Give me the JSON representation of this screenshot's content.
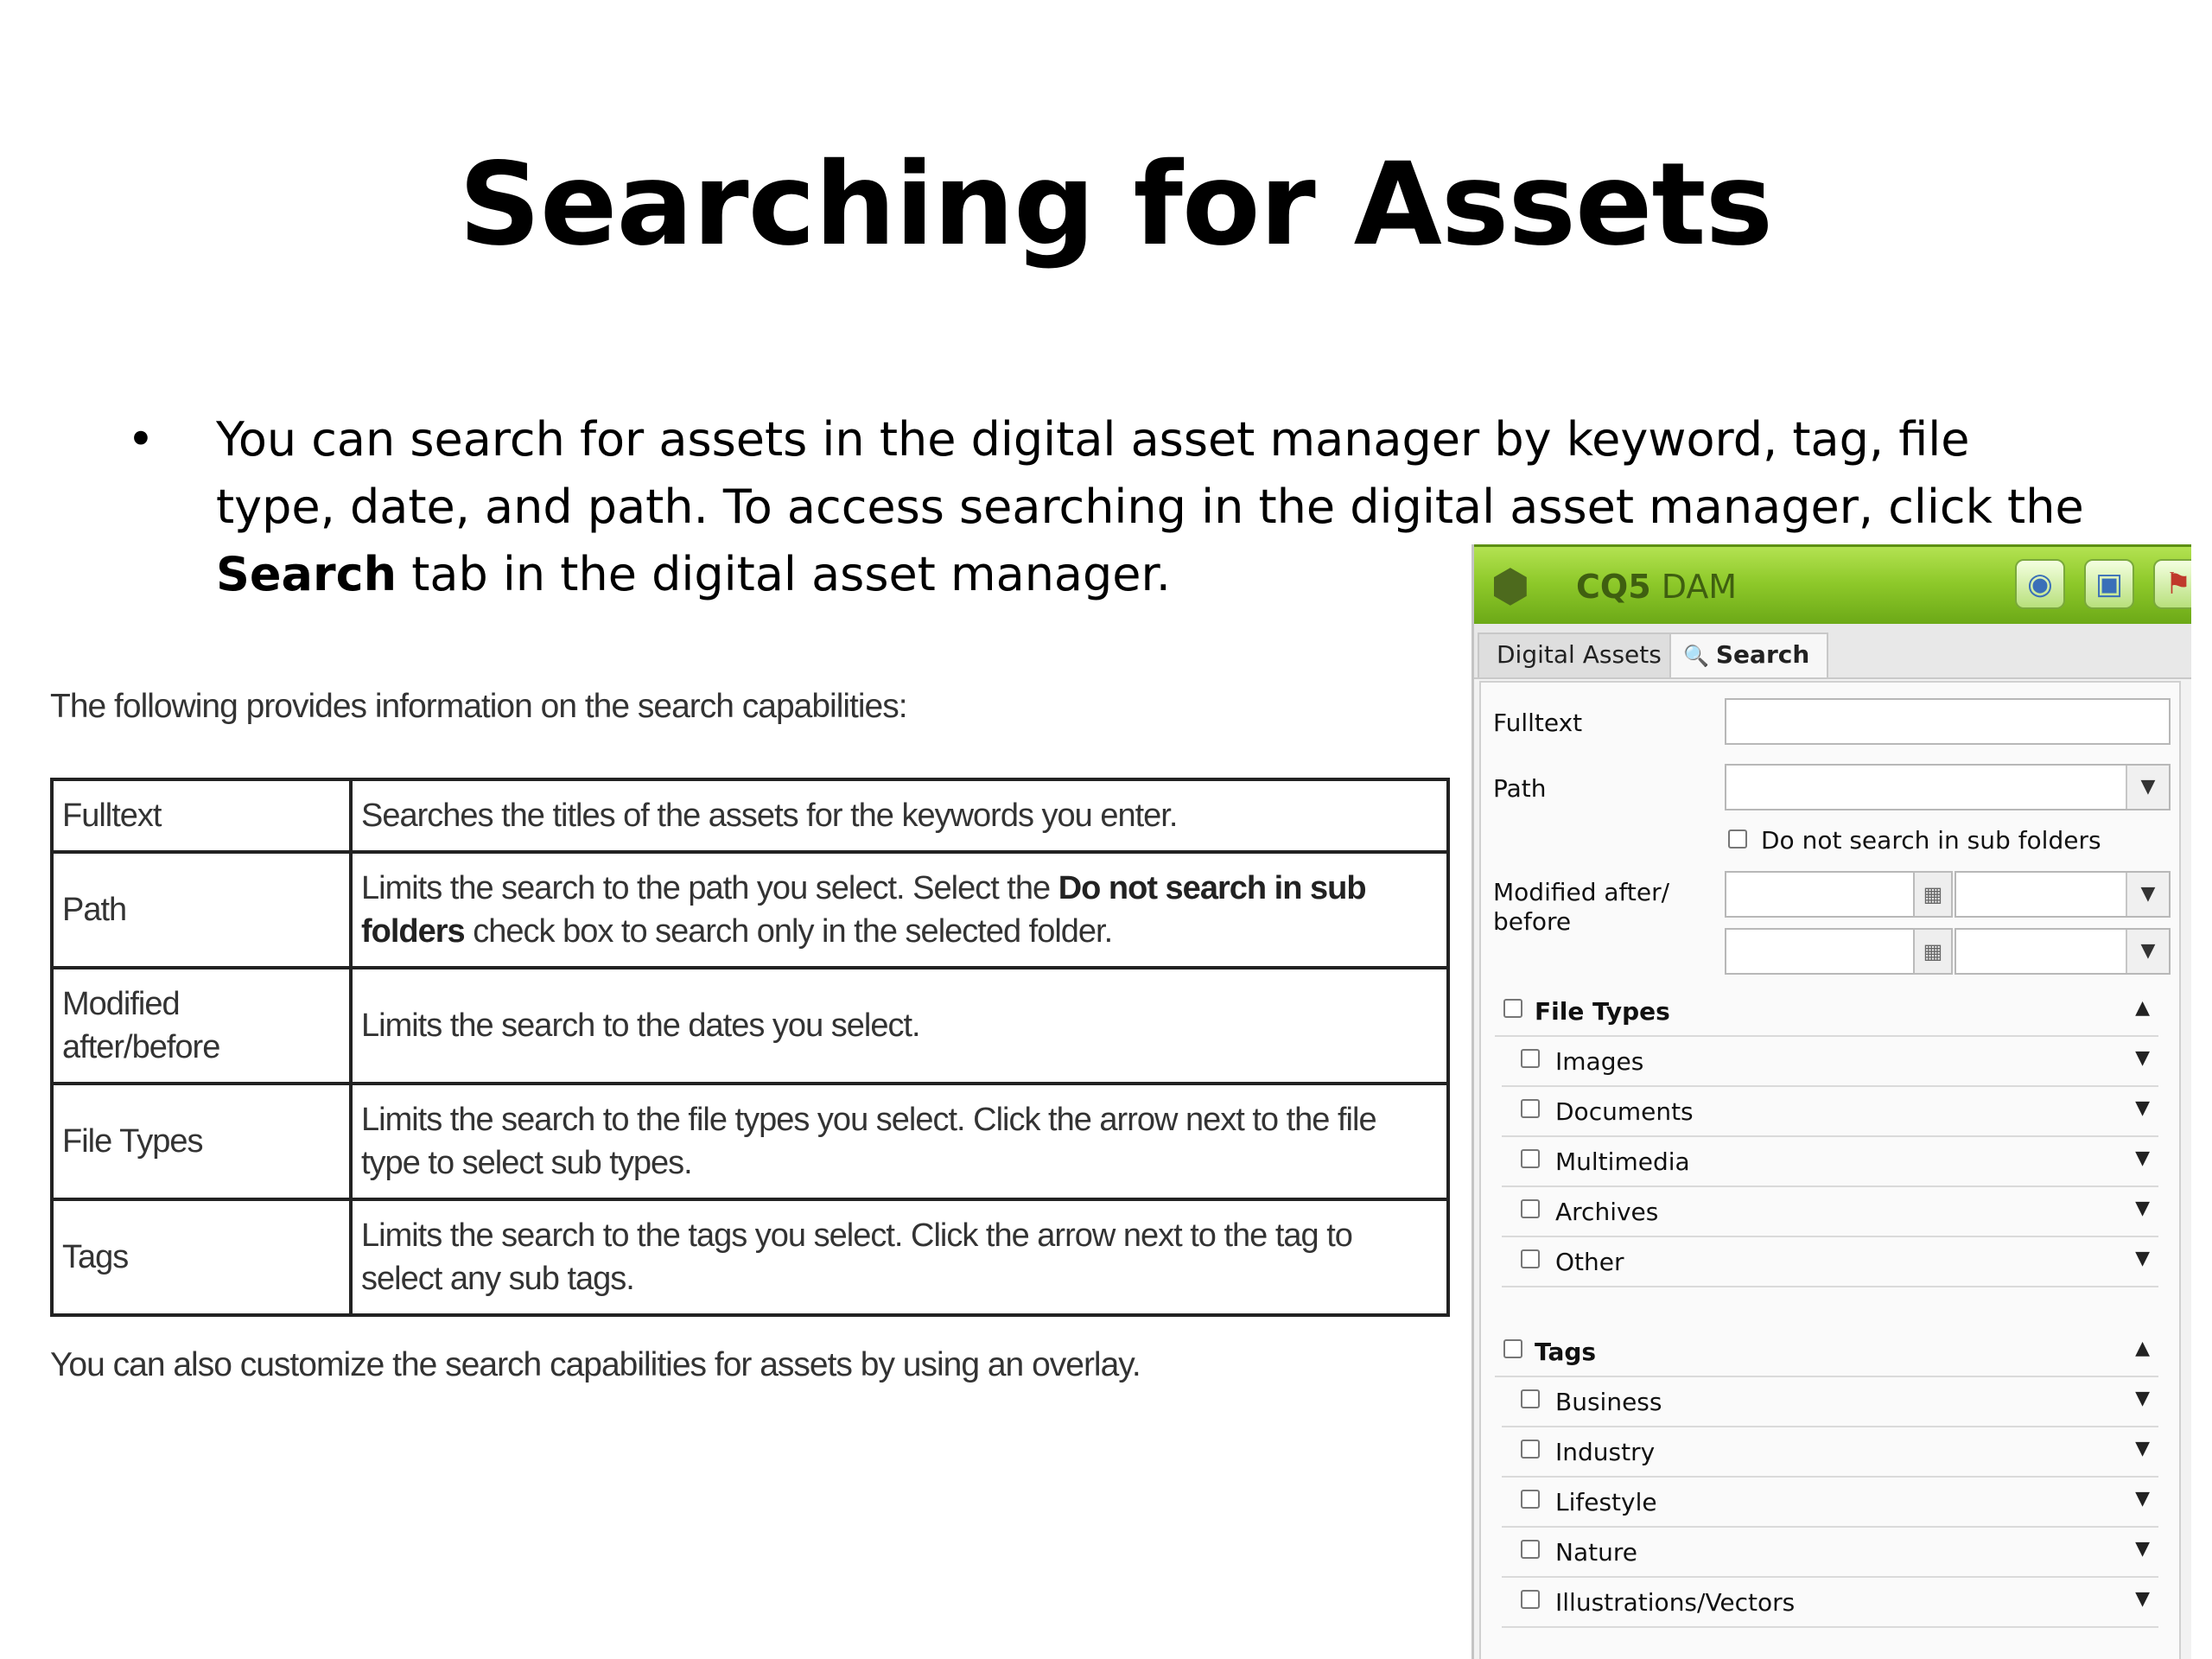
{
  "slide": {
    "title": "Searching for Assets",
    "bullet_dot": "•",
    "bullet_part1": "You can search for assets in the digital asset manager by keyword, tag, file type, date, and path. To access searching in the digital asset manager, click the ",
    "bullet_bold": "Search",
    "bullet_part2": " tab in the digital asset manager."
  },
  "doc": {
    "intro": "The following provides information on the search capabilities:",
    "rows": [
      {
        "term": "Fulltext",
        "desc": "Searches the titles of the assets for the keywords you enter."
      },
      {
        "term": "Path",
        "desc_pre": "Limits the search to the path you select. Select the ",
        "desc_bold": "Do not search in sub folders",
        "desc_post": " check box to search only in the selected folder."
      },
      {
        "term": "Modified after/before",
        "desc": "Limits the search to the dates you select."
      },
      {
        "term": "File Types",
        "desc": "Limits the search to the file types you select. Click the arrow next to the file type to select sub types."
      },
      {
        "term": "Tags",
        "desc": "Limits the search to the tags you select. Click the arrow next to the tag to select any sub tags."
      }
    ],
    "outro": "You can also customize the search capabilities for assets by using an overlay."
  },
  "dam": {
    "title_bold": "CQ5",
    "title_rest": " DAM",
    "tabs": [
      "Digital Assets",
      "Search"
    ],
    "labels": {
      "fulltext": "Fulltext",
      "path": "Path",
      "no_subfolders": "Do not search in sub folders",
      "modified_1": "Modified after/",
      "modified_2": "before"
    },
    "fulltext_value": "",
    "file_types": {
      "label": "File Types",
      "items": [
        "Images",
        "Documents",
        "Multimedia",
        "Archives",
        "Other"
      ]
    },
    "tags": {
      "label": "Tags",
      "items": [
        "Business",
        "Industry",
        "Lifestyle",
        "Nature",
        "Illustrations/Vectors"
      ]
    }
  },
  "icons": {
    "up": "▲",
    "down": "▼",
    "select_down": "⌄",
    "search": "🔍",
    "calendar": "▦",
    "logo": "⬢",
    "globe": "◉",
    "camera": "▣",
    "flag": "⚑"
  }
}
